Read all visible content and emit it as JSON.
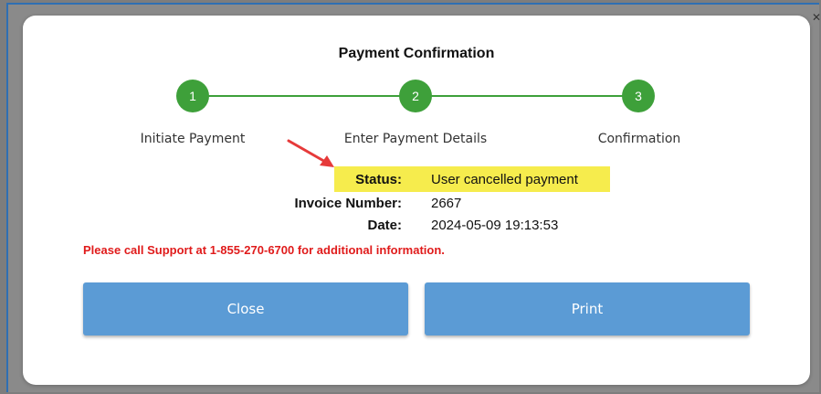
{
  "window": {
    "close_glyph": "✕"
  },
  "dialog": {
    "title": "Payment Confirmation",
    "steps": [
      {
        "number": "1",
        "label": "Initiate Payment"
      },
      {
        "number": "2",
        "label": "Enter Payment Details"
      },
      {
        "number": "3",
        "label": "Confirmation"
      }
    ],
    "status_label": "Status:",
    "status_value": "User cancelled payment",
    "invoice_label": "Invoice Number:",
    "invoice_value": "2667",
    "date_label": "Date:",
    "date_value": "2024-05-09 19:13:53",
    "support_message": "Please call Support at 1-855-270-6700 for additional information.",
    "close_button": "Close",
    "print_button": "Print"
  },
  "colors": {
    "step_green": "#3ea03a",
    "highlight_yellow": "#f6ec4d",
    "button_blue": "#5b9bd5",
    "error_red": "#e01b1b",
    "annotation_arrow": "#e63a3a"
  },
  "icons": {
    "annotation": "red-arrow-icon"
  }
}
